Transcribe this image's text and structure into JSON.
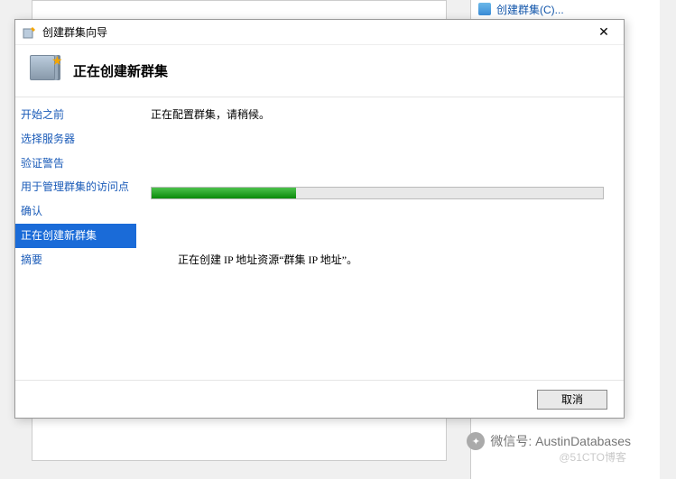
{
  "background": {
    "top_item_label": "创建群集(C)..."
  },
  "dialog": {
    "title": "创建群集向导",
    "header": "正在创建新群集",
    "sidebar": {
      "items": [
        {
          "label": "开始之前"
        },
        {
          "label": "选择服务器"
        },
        {
          "label": "验证警告"
        },
        {
          "label": "用于管理群集的访问点"
        },
        {
          "label": "确认"
        },
        {
          "label": "正在创建新群集"
        },
        {
          "label": "摘要"
        }
      ],
      "active_index": 5
    },
    "main": {
      "status": "正在配置群集，请稍候。",
      "progress_percent": 32,
      "detail": "正在创建 IP 地址资源“群集 IP 地址”。"
    },
    "footer": {
      "cancel_label": "取消"
    }
  },
  "watermark": {
    "line1": "微信号: AustinDatabases",
    "line2": "@51CTO博客"
  }
}
